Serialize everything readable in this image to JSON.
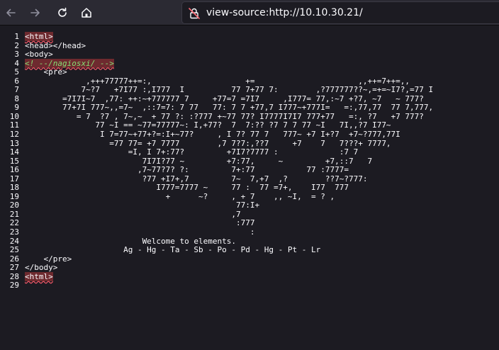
{
  "toolbar": {
    "back": "back-arrow-icon",
    "forward": "forward-arrow-icon",
    "reload": "reload-icon",
    "home": "home-icon"
  },
  "urlbar": {
    "icon": "insecure-lock-icon",
    "url": "view-source:http://10.10.30.21/"
  },
  "source": {
    "line_numbers": [
      "1",
      "2",
      "3",
      "4",
      "5",
      "6",
      "7",
      "8",
      "9",
      "10",
      "11",
      "12",
      "13",
      "14",
      "15",
      "16",
      "17",
      "18",
      "19",
      "20",
      "21",
      "22",
      "23",
      "24",
      "25",
      "26",
      "27",
      "28",
      "29"
    ],
    "l1_tag": "<html>",
    "l2_head_open": "<head>",
    "l2_head_close": "</head>",
    "l3_body": "<body>",
    "l4_comment": "<! --/nagiosxi/ -->",
    "l5_pre": "<pre>",
    "art": [
      "             ,+++77777++=:,                    +=                      ,,++=7++=,,",
      "            7~?7   +7I77 :,I777  I          77 7+77 7:        ,?777777??~,=+=~I7?,=77 I",
      "        =7I7I~7  ,77: ++:~+777777 7     +77=7 =7I7     ,I777= 77,:~7 +?7, ~7   ~ 777?",
      "        77+7I 777~,,=7~  ,::7=7: 7 77   77: 7 7 +77,7 I777~+777I=   =:,77,77  77 7,777,",
      "           = 7  ?7 , 7~,~  + 77 ?: :?777 +~77 77? I7777I7I7 777+77   =:, ?7   +7 777?",
      "               77 ~I == ~77=77777~: I,+77?  7  7:?? ?7 7 7 77 ~I   7I,,?7 I77~",
      "                I 7=77~+77+?=:I+~77?     , I 7? 77 7   777~ +7 I+?7  +7~?777,77I",
      "                  =77 77= +7 7777        ,7 7?7:,??7     +7    7   7???+ 7777,",
      "                      =I, I 7+:77?         +7I7?7777 :             :7 7",
      "                         7I7I?77 ~         +7:77,     ~         +7,::7   7",
      "                        ,7~77?7? ?:         7+:77           77 :7777=",
      "                         ?77 +I7+,7         7~  7,+7  ,?        ??7~?777:",
      "                            I777=7777 ~     77 :  77 =7+,    I77  777",
      "                              +      ~?     , + 7    ,, ~I,  = ? ,",
      "                                             77:I+",
      "                                            ,7",
      "                                             :777",
      "                                                :",
      "                         Welcome to elements.",
      "                     Ag - Hg - Ta - Sb - Po - Pd - Hg - Pt - Lr"
    ],
    "l26_pre_close": "</pre>",
    "l27_body_close": "</body>",
    "l28_tag": "<html>"
  }
}
